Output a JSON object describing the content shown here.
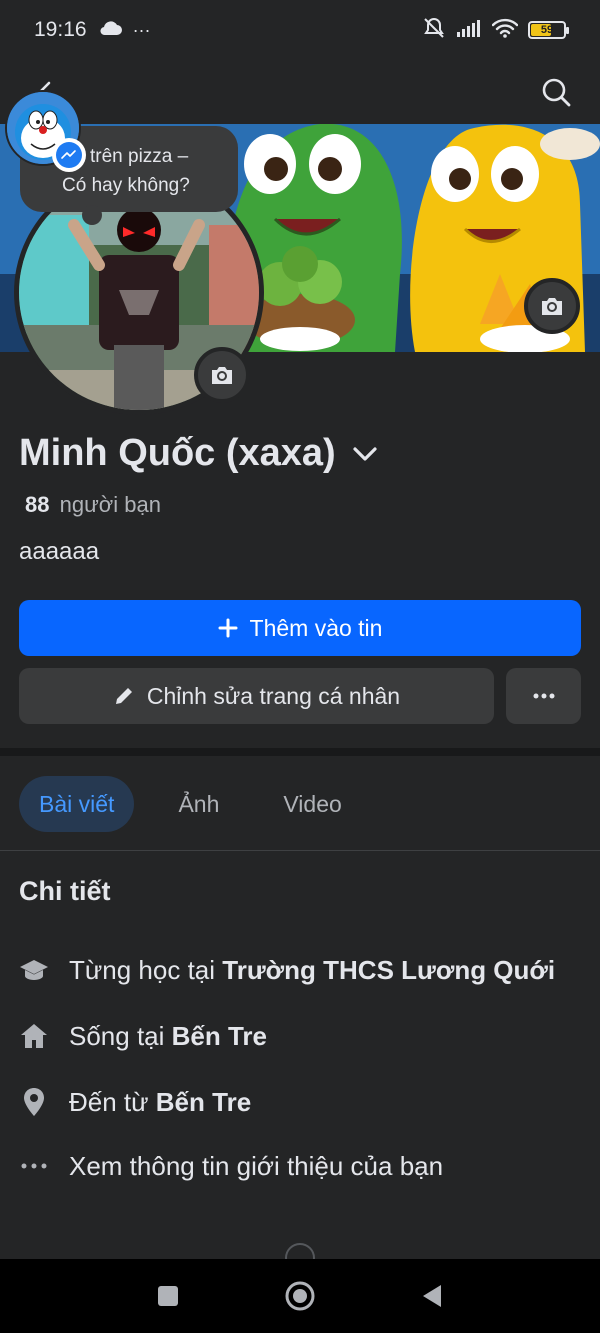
{
  "status_bar": {
    "time": "19:16",
    "more": "···",
    "battery": "59"
  },
  "note": {
    "line1": "trên pizza –",
    "line2": "Có hay không?"
  },
  "profile": {
    "name": "Minh Quốc (xaxa)",
    "friends_count": "88",
    "friends_label": "người bạn",
    "bio": "aaaaaa"
  },
  "actions": {
    "add_story": "Thêm vào tin",
    "edit_profile": "Chỉnh sửa trang cá nhân",
    "more": "···"
  },
  "tabs": [
    {
      "label": "Bài viết",
      "active": true
    },
    {
      "label": "Ảnh",
      "active": false
    },
    {
      "label": "Video",
      "active": false
    }
  ],
  "details": {
    "title": "Chi tiết",
    "items": [
      {
        "prefix": "Từng học tại ",
        "value": "Trường THCS Lương Quới",
        "icon": "graduation-cap-icon"
      },
      {
        "prefix": "Sống tại ",
        "value": "Bến Tre",
        "icon": "home-icon"
      },
      {
        "prefix": "Đến từ ",
        "value": "Bến Tre",
        "icon": "location-pin-icon"
      },
      {
        "prefix": "Xem thông tin giới thiệu của bạn",
        "value": "",
        "icon": "more-dots-icon"
      }
    ]
  },
  "colors": {
    "background": "#242526",
    "primary": "#0866ff",
    "secondary_button": "#3a3b3c",
    "active_tab_bg": "#263951",
    "active_tab_text": "#4599ff"
  }
}
